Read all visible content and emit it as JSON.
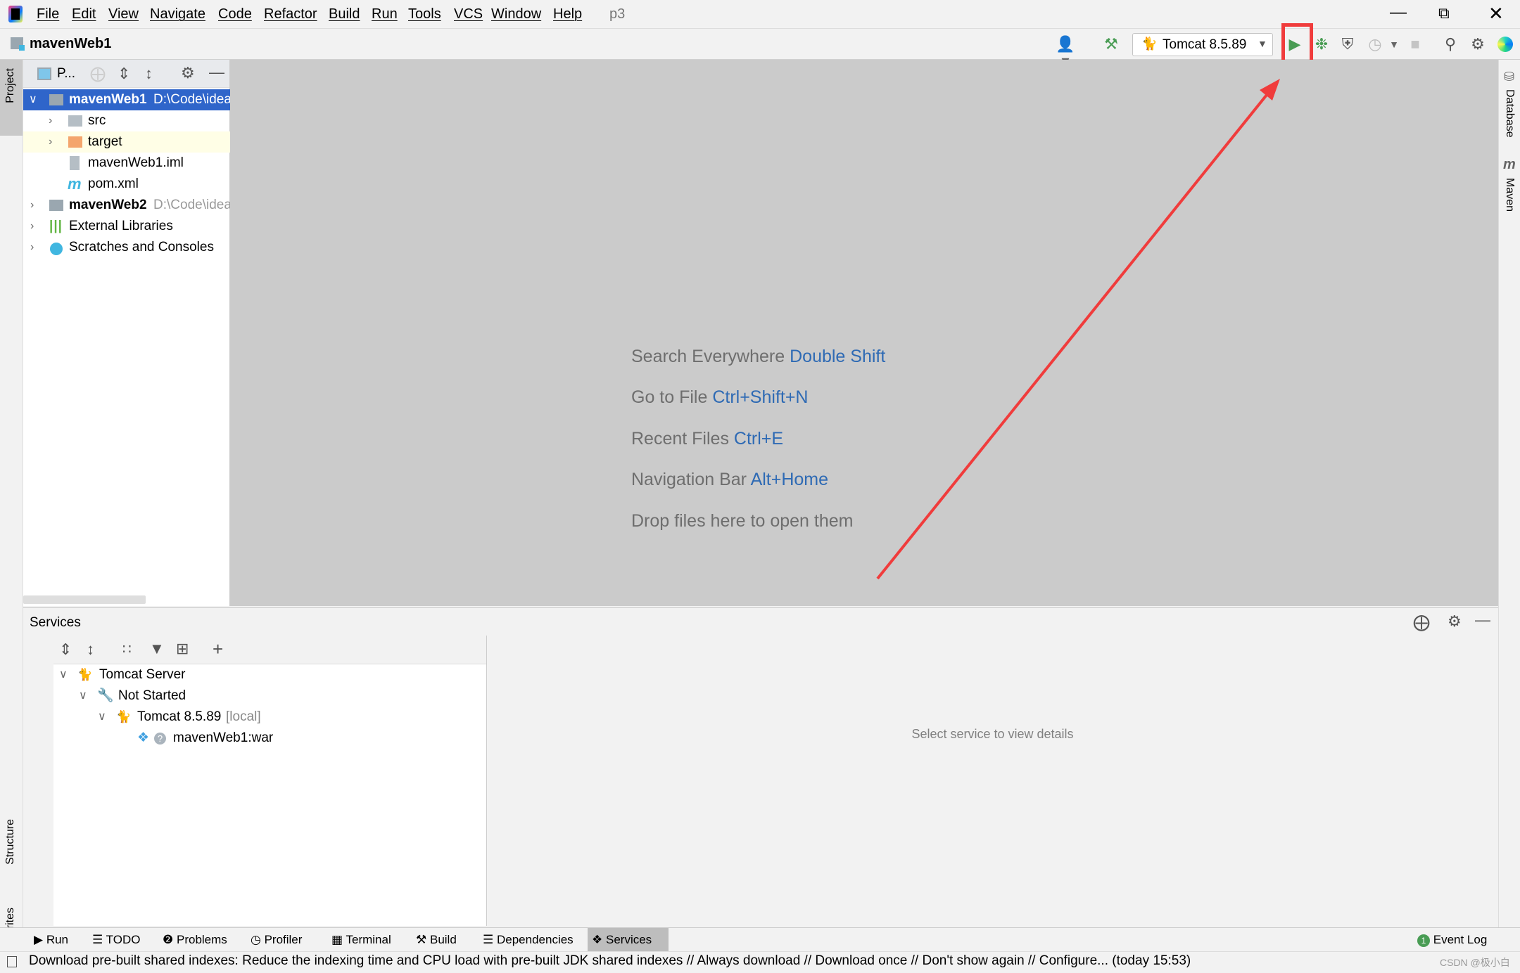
{
  "menubar": {
    "items": [
      "File",
      "Edit",
      "View",
      "Navigate",
      "Code",
      "Refactor",
      "Build",
      "Run",
      "Tools",
      "VCS",
      "Window",
      "Help"
    ],
    "project_hint": "p3"
  },
  "toolbar": {
    "breadcrumb": "mavenWeb1",
    "run_config": "Tomcat 8.5.89"
  },
  "left_stripe": {
    "project": "Project",
    "structure": "Structure",
    "favorites": "Favorites"
  },
  "right_stripe": {
    "database": "Database",
    "maven": "Maven"
  },
  "project_panel": {
    "view_selector": "P...",
    "tree": [
      {
        "label": "mavenWeb1",
        "path": "D:\\Code\\idea"
      },
      {
        "label": "src"
      },
      {
        "label": "target"
      },
      {
        "label": "mavenWeb1.iml"
      },
      {
        "label": "pom.xml"
      },
      {
        "label": "mavenWeb2",
        "path": "D:\\Code\\idea"
      },
      {
        "label": "External Libraries"
      },
      {
        "label": "Scratches and Consoles"
      }
    ]
  },
  "editor": {
    "hints": [
      {
        "text": "Search Everywhere",
        "key": "Double Shift"
      },
      {
        "text": "Go to File",
        "key": "Ctrl+Shift+N"
      },
      {
        "text": "Recent Files",
        "key": "Ctrl+E"
      },
      {
        "text": "Navigation Bar",
        "key": "Alt+Home"
      },
      {
        "text": "Drop files here to open them",
        "key": ""
      }
    ]
  },
  "services": {
    "title": "Services",
    "tree": [
      {
        "label": "Tomcat Server"
      },
      {
        "label": "Not Started"
      },
      {
        "label": "Tomcat 8.5.89",
        "suffix": "[local]"
      },
      {
        "label": "mavenWeb1:war"
      }
    ],
    "details_placeholder": "Select service to view details"
  },
  "bottom_tabs": [
    "Run",
    "TODO",
    "Problems",
    "Profiler",
    "Terminal",
    "Build",
    "Dependencies",
    "Services"
  ],
  "event_log": {
    "label": "Event Log",
    "count": "1"
  },
  "status": {
    "message": "Download pre-built shared indexes: Reduce the indexing time and CPU load with pre-built JDK shared indexes // Always download // Download once // Don't show again // Configure... (today 15:53)",
    "watermark": "CSDN @极小白"
  },
  "colors": {
    "selection": "#2f65ca",
    "annotation": "#f03c3c",
    "run_green": "#499c54",
    "link_blue": "#2e6ab4"
  }
}
